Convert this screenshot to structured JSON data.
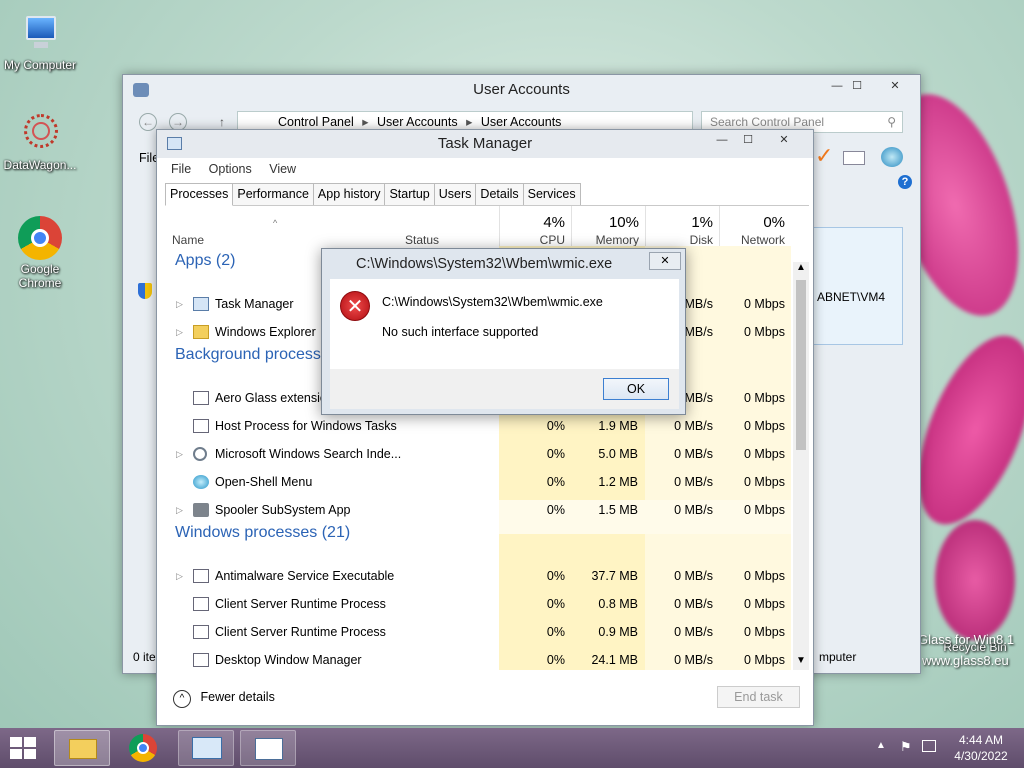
{
  "desktop": {
    "icons": [
      {
        "label": "My Computer",
        "icon": "computer-icon"
      },
      {
        "label": "DataWagon...",
        "icon": "datawagon-icon"
      },
      {
        "label": "Google Chrome",
        "icon": "chrome-icon"
      }
    ],
    "recycle_bin": "Recycle Bin",
    "watermark_line1": "Glass for Win8.1",
    "watermark_line2": "www.glass8.eu"
  },
  "user_accounts": {
    "title": "User Accounts",
    "breadcrumb": [
      "Control Panel",
      "User Accounts",
      "User Accounts"
    ],
    "search_placeholder": "Search Control Panel",
    "menu_file": "File",
    "account_text": "ABNET\\VM4",
    "status_left": "0 items",
    "status_right": "mputer"
  },
  "task_manager": {
    "title": "Task Manager",
    "menu": [
      "File",
      "Options",
      "View"
    ],
    "tabs": [
      "Processes",
      "Performance",
      "App history",
      "Startup",
      "Users",
      "Details",
      "Services"
    ],
    "active_tab": "Processes",
    "columns": {
      "name": "Name",
      "status": "Status",
      "cpu_pct": "4%",
      "cpu": "CPU",
      "mem_pct": "10%",
      "mem": "Memory",
      "disk_pct": "1%",
      "disk": "Disk",
      "net_pct": "0%",
      "net": "Network"
    },
    "groups": {
      "apps": "Apps (2)",
      "background": "Background processes",
      "windows": "Windows processes (21)"
    },
    "apps": [
      {
        "name": "Task Manager",
        "disk": "MB/s",
        "net": "0 Mbps"
      },
      {
        "name": "Windows Explorer",
        "disk": "MB/s",
        "net": "0 Mbps"
      }
    ],
    "background": [
      {
        "name": "Aero Glass extension",
        "cpu": "",
        "mem": "",
        "disk": "MB/s",
        "net": "0 Mbps"
      },
      {
        "name": "Host Process for Windows Tasks",
        "cpu": "0%",
        "mem": "1.9 MB",
        "disk": "0 MB/s",
        "net": "0 Mbps"
      },
      {
        "name": "Microsoft Windows Search Inde...",
        "cpu": "0%",
        "mem": "5.0 MB",
        "disk": "0 MB/s",
        "net": "0 Mbps"
      },
      {
        "name": "Open-Shell Menu",
        "cpu": "0%",
        "mem": "1.2 MB",
        "disk": "0 MB/s",
        "net": "0 Mbps"
      },
      {
        "name": "Spooler SubSystem App",
        "cpu": "0%",
        "mem": "1.5 MB",
        "disk": "0 MB/s",
        "net": "0 Mbps"
      }
    ],
    "windows": [
      {
        "name": "Antimalware Service Executable",
        "cpu": "0%",
        "mem": "37.7 MB",
        "disk": "0 MB/s",
        "net": "0 Mbps"
      },
      {
        "name": "Client Server Runtime Process",
        "cpu": "0%",
        "mem": "0.8 MB",
        "disk": "0 MB/s",
        "net": "0 Mbps"
      },
      {
        "name": "Client Server Runtime Process",
        "cpu": "0%",
        "mem": "0.9 MB",
        "disk": "0 MB/s",
        "net": "0 Mbps"
      },
      {
        "name": "Desktop Window Manager",
        "cpu": "0%",
        "mem": "24.1 MB",
        "disk": "0 MB/s",
        "net": "0 Mbps"
      }
    ],
    "fewer_details": "Fewer details",
    "end_task": "End task"
  },
  "dialog": {
    "title": "C:\\Windows\\System32\\Wbem\\wmic.exe",
    "path": "C:\\Windows\\System32\\Wbem\\wmic.exe",
    "message": "No such interface supported",
    "ok": "OK",
    "icon": "error-icon"
  },
  "taskbar": {
    "items": [
      "file-explorer-icon",
      "chrome-icon",
      "control-panel-icon",
      "task-manager-icon"
    ],
    "time": "4:44 AM",
    "date": "4/30/2022"
  },
  "colors": {
    "accent": "#2b63b5",
    "cpu_highlight": "#fff4c4",
    "taskbar": "#6e5a7a",
    "error": "#c4161c"
  }
}
